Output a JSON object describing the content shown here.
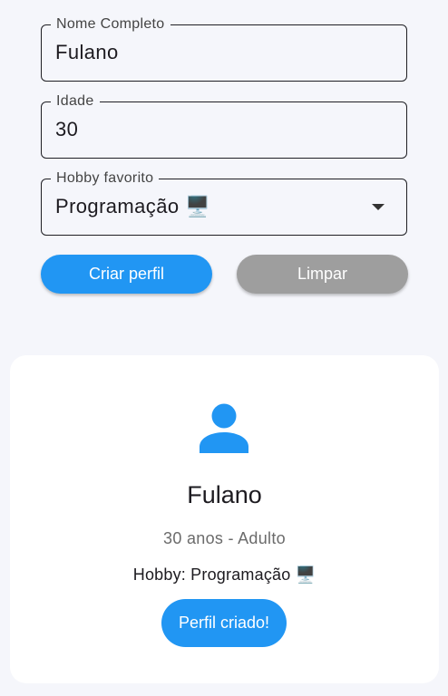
{
  "form": {
    "name_field": {
      "label": "Nome Completo",
      "value": "Fulano"
    },
    "age_field": {
      "label": "Idade",
      "value": "30"
    },
    "hobby_field": {
      "label": "Hobby favorito",
      "value": "Programação 🖥️"
    },
    "create_button": "Criar perfil",
    "clear_button": "Limpar"
  },
  "profile": {
    "icon": "person-icon",
    "name": "Fulano",
    "age_line": "30 anos - Adulto",
    "hobby_line": "Hobby: Programação 🖥️",
    "status_badge": "Perfil criado!"
  },
  "colors": {
    "accent": "#2196f3",
    "secondary_button": "#9e9e9e",
    "background": "#f5f6fb",
    "card": "#ffffff"
  }
}
